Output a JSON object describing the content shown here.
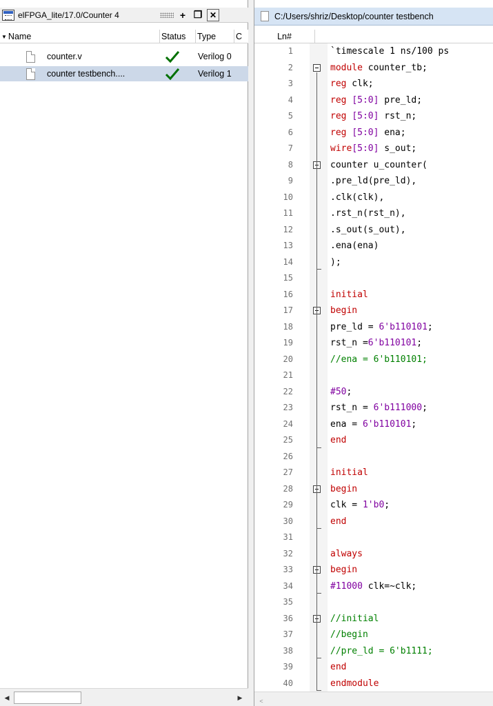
{
  "project_pane": {
    "title": "elFPGA_lite/17.0/Counter 4",
    "columns": [
      "Name",
      "Status",
      "Type",
      "C"
    ],
    "files": [
      {
        "name": "counter.v",
        "type": "Verilog 0"
      },
      {
        "name": "counter testbench....",
        "type": "Verilog 1"
      }
    ]
  },
  "editor": {
    "tab_title": "C:/Users/shriz/Desktop/counter testbench",
    "ln_header": "Ln#",
    "lines": [
      {
        "n": "1",
        "t": "`timescale 1 ns/100 ps",
        "c": "txt"
      },
      {
        "n": "2",
        "t": "module counter_tb;",
        "c": "mod"
      },
      {
        "n": "3",
        "t": "reg clk;",
        "c": "reg"
      },
      {
        "n": "4",
        "t": "reg [5:0] pre_ld;",
        "c": "reg"
      },
      {
        "n": "5",
        "t": "reg [5:0] rst_n;",
        "c": "reg"
      },
      {
        "n": "6",
        "t": "reg [5:0] ena;",
        "c": "reg"
      },
      {
        "n": "7",
        "t": "wire[5:0] s_out;",
        "c": "wire"
      },
      {
        "n": "8",
        "t": "counter u_counter(",
        "c": "txt"
      },
      {
        "n": "9",
        "t": ".pre_ld(pre_ld),",
        "c": "txt"
      },
      {
        "n": "10",
        "t": ".clk(clk),",
        "c": "txt"
      },
      {
        "n": "11",
        "t": ".rst_n(rst_n),",
        "c": "txt"
      },
      {
        "n": "12",
        "t": ".s_out(s_out),",
        "c": "txt"
      },
      {
        "n": "13",
        "t": ".ena(ena)",
        "c": "txt"
      },
      {
        "n": "14",
        "t": ");",
        "c": "txt"
      },
      {
        "n": "15",
        "t": "",
        "c": "txt"
      },
      {
        "n": "16",
        "t": "initial",
        "c": "kw"
      },
      {
        "n": "17",
        "t": "begin",
        "c": "kw"
      },
      {
        "n": "18",
        "t": "pre_ld = 6'b110101;",
        "c": "assign"
      },
      {
        "n": "19",
        "t": "rst_n =6'b110101;",
        "c": "assign"
      },
      {
        "n": "20",
        "t": "//ena = 6'b110101;",
        "c": "cm"
      },
      {
        "n": "21",
        "t": "",
        "c": "txt"
      },
      {
        "n": "22",
        "t": "#50;",
        "c": "delay"
      },
      {
        "n": "23",
        "t": "rst_n = 6'b111000;",
        "c": "assign"
      },
      {
        "n": "24",
        "t": "ena = 6'b110101;",
        "c": "assign"
      },
      {
        "n": "25",
        "t": "end",
        "c": "kw"
      },
      {
        "n": "26",
        "t": "",
        "c": "txt"
      },
      {
        "n": "27",
        "t": "initial",
        "c": "kw"
      },
      {
        "n": "28",
        "t": "begin",
        "c": "kw"
      },
      {
        "n": "29",
        "t": "clk = 1'b0;",
        "c": "assign"
      },
      {
        "n": "30",
        "t": "end",
        "c": "kw"
      },
      {
        "n": "31",
        "t": "",
        "c": "txt"
      },
      {
        "n": "32",
        "t": "always",
        "c": "kw"
      },
      {
        "n": "33",
        "t": "begin",
        "c": "kw"
      },
      {
        "n": "34",
        "t": "#11000 clk=~clk;",
        "c": "delay2"
      },
      {
        "n": "35",
        "t": "",
        "c": "txt"
      },
      {
        "n": "36",
        "t": "//initial",
        "c": "cm"
      },
      {
        "n": "37",
        "t": "//begin",
        "c": "cm"
      },
      {
        "n": "38",
        "t": "//pre_ld = 6'b1111;",
        "c": "cm"
      },
      {
        "n": "39",
        "t": "end",
        "c": "kw"
      },
      {
        "n": "40",
        "t": "endmodule",
        "c": "kw"
      }
    ]
  },
  "colors": {
    "keyword": "#c00000",
    "comment": "#008000",
    "number": "#8000a0",
    "selection": "#ccd8e8"
  },
  "icons": [
    "window-icon",
    "add-icon",
    "restore-icon",
    "close-icon",
    "file-icon",
    "check-icon",
    "fold-icon",
    "scroll-left-icon",
    "scroll-right-icon"
  ]
}
